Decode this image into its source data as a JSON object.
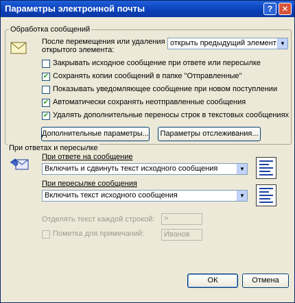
{
  "window": {
    "title": "Параметры электронной почты",
    "help": "?",
    "close": "✕"
  },
  "processing": {
    "group_label": "Обработка сообщений",
    "after_move_label": "После перемещения или удаления открытого элемента:",
    "after_move_value": "открыть предыдущий элемент",
    "options": [
      {
        "label": "Закрывать исходное сообщение при ответе или пересылке",
        "checked": false
      },
      {
        "label": "Сохранять копии сообщений в папке \"Отправленные\"",
        "checked": true
      },
      {
        "label": "Показывать уведомляющее сообщение при новом поступлении",
        "checked": false
      },
      {
        "label": "Автоматически сохранять неотправленные сообщения",
        "checked": true
      },
      {
        "label": "Удалять дополнительные переносы строк в текстовых сообщениях",
        "checked": true
      }
    ],
    "advanced_button": "Дополнительные параметры...",
    "tracking_button": "Параметры отслеживания..."
  },
  "replies": {
    "group_label": "При ответах и пересылке",
    "reply_label": "При ответе на сообщение",
    "reply_value": "Включить и сдвинуть текст исходного сообщения",
    "forward_label": "При пересылке сообщения",
    "forward_value": "Включить текст исходного сообщения",
    "prefix_label": "Отделять текст каждой строкой:",
    "prefix_value": ">",
    "mark_label": "Пометка для примечаний:",
    "mark_value": "Иванов"
  },
  "footer": {
    "ok": "ОК",
    "cancel": "Отмена"
  },
  "icons": {
    "envelope": "envelope-icon",
    "reply": "reply-options-icon",
    "doc_preview_reply": "document-preview-icon",
    "doc_preview_forward": "document-preview-icon"
  }
}
